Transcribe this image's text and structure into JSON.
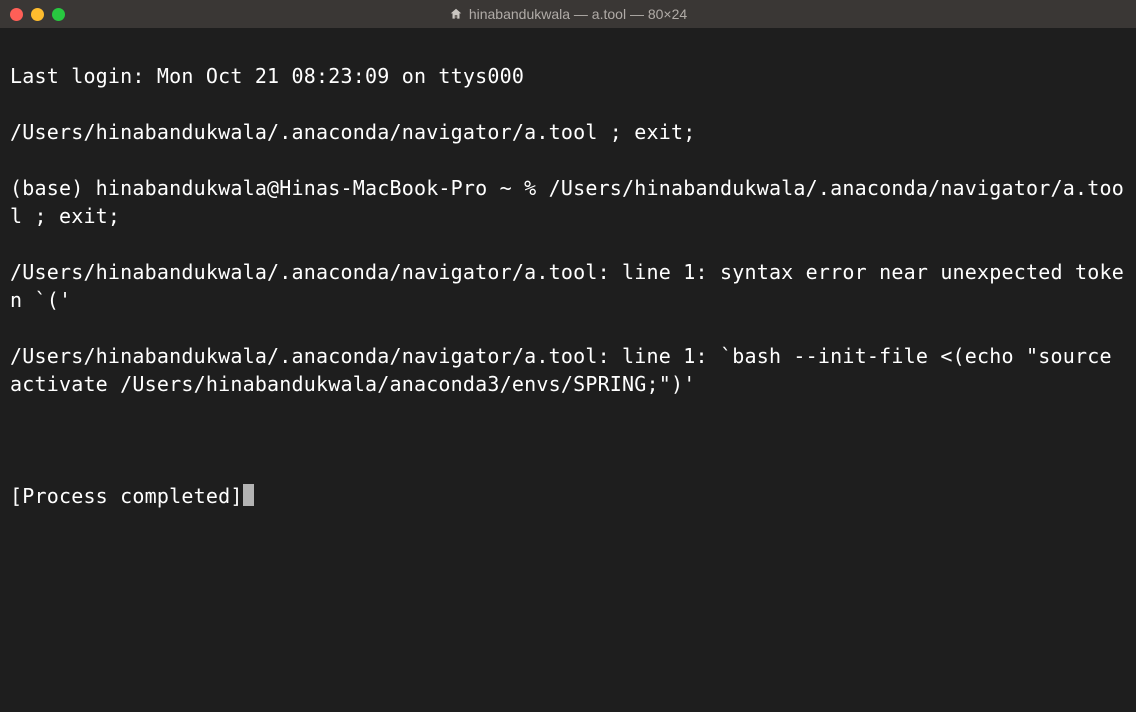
{
  "window": {
    "title": "hinabandukwala — a.tool — 80×24",
    "home_icon": "home-icon"
  },
  "terminal": {
    "lines": {
      "l0": "Last login: Mon Oct 21 08:23:09 on ttys000",
      "l1": "/Users/hinabandukwala/.anaconda/navigator/a.tool ; exit;",
      "l2": "(base) hinabandukwala@Hinas-MacBook-Pro ~ % /Users/hinabandukwala/.anaconda/navigator/a.tool ; exit;",
      "l3": "/Users/hinabandukwala/.anaconda/navigator/a.tool: line 1: syntax error near unexpected token `('",
      "l4": "/Users/hinabandukwala/.anaconda/navigator/a.tool: line 1: `bash --init-file <(echo \"source activate /Users/hinabandukwala/anaconda3/envs/SPRING;\")'",
      "l5": "[Process completed]"
    }
  }
}
